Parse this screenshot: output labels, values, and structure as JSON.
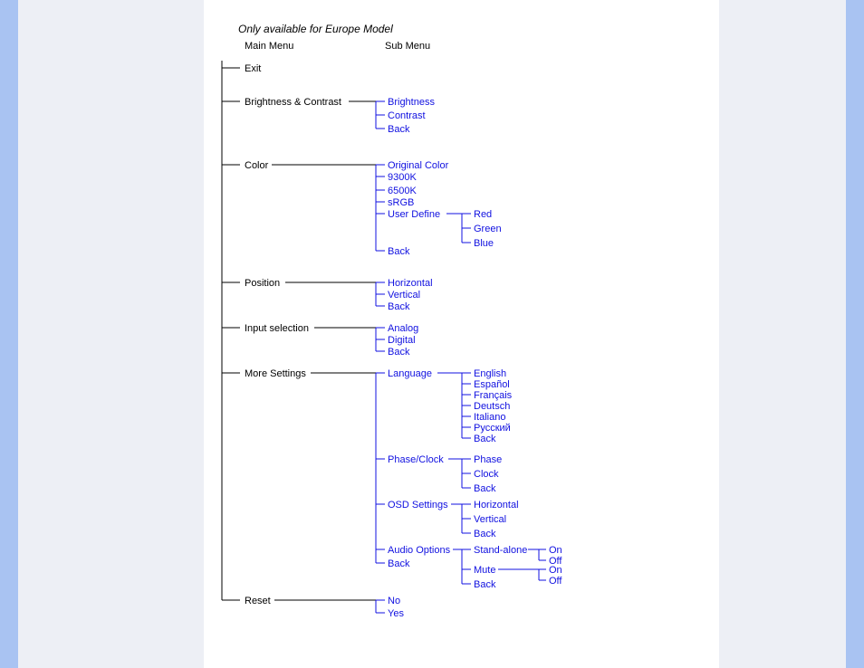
{
  "title": "Only available for Europe Model",
  "headers": {
    "main": "Main Menu",
    "sub": "Sub Menu"
  },
  "menu": [
    {
      "label": "Exit"
    },
    {
      "label": "Brightness & Contrast",
      "sub": [
        "Brightness",
        "Contrast",
        "Back"
      ]
    },
    {
      "label": "Color",
      "sub": [
        "Original Color",
        "9300K",
        "6500K",
        "sRGB",
        "User Define",
        "Back"
      ],
      "userdef": [
        "Red",
        "Green",
        "Blue"
      ]
    },
    {
      "label": "Position",
      "sub": [
        "Horizontal",
        "Vertical",
        "Back"
      ]
    },
    {
      "label": "Input selection",
      "sub": [
        "Analog",
        "Digital",
        "Back"
      ]
    },
    {
      "label": "More Settings",
      "sub": [
        "Language",
        "Phase/Clock",
        "OSD Settings",
        "Audio Options",
        "Back"
      ],
      "lang": [
        "English",
        "Español",
        "Français",
        "Deutsch",
        "Italiano",
        "Русский",
        "Back"
      ],
      "phase": [
        "Phase",
        "Clock",
        "Back"
      ],
      "osd": [
        "Horizontal",
        "Vertical",
        "Back"
      ],
      "audio": [
        "Stand-alone",
        "Mute",
        "Back"
      ],
      "standalone": [
        "On",
        "Off"
      ],
      "mute": [
        "On",
        "Off"
      ]
    },
    {
      "label": "Reset",
      "sub": [
        "No",
        "Yes"
      ]
    }
  ]
}
